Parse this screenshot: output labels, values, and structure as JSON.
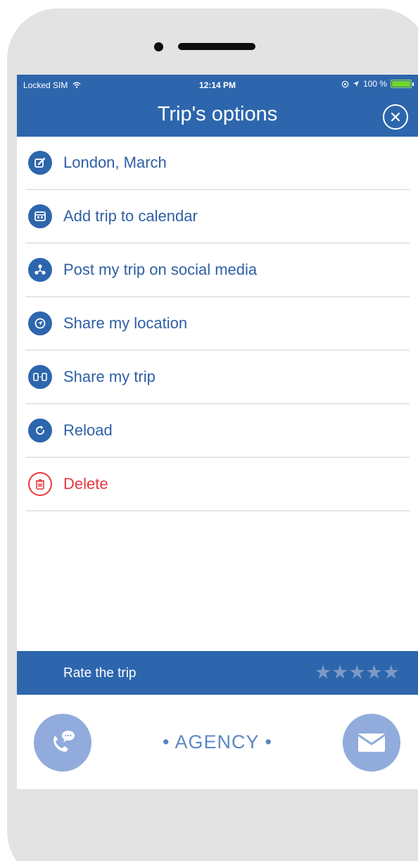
{
  "status_bar": {
    "carrier": "Locked SIM",
    "time": "12:14 PM",
    "battery_text": "100 %"
  },
  "header": {
    "title": "Trip's options"
  },
  "menu": {
    "items": [
      {
        "label": "London, March",
        "icon": "edit-icon"
      },
      {
        "label": "Add trip to calendar",
        "icon": "calendar-icon"
      },
      {
        "label": "Post my trip on social media",
        "icon": "social-icon"
      },
      {
        "label": "Share my location",
        "icon": "location-icon"
      },
      {
        "label": "Share my trip",
        "icon": "share-icon"
      },
      {
        "label": "Reload",
        "icon": "reload-icon"
      },
      {
        "label": "Delete",
        "icon": "trash-icon"
      }
    ]
  },
  "rating": {
    "label": "Rate the trip",
    "stars": "★★★★★",
    "filled_stars": 0,
    "max_stars": 5
  },
  "footer": {
    "agency_text": "• AGENCY •"
  },
  "colors": {
    "primary_blue": "#2d66ad",
    "delete_red": "#e5393f",
    "button_light_blue": "#91acdc",
    "battery_green": "#6fd62c"
  }
}
